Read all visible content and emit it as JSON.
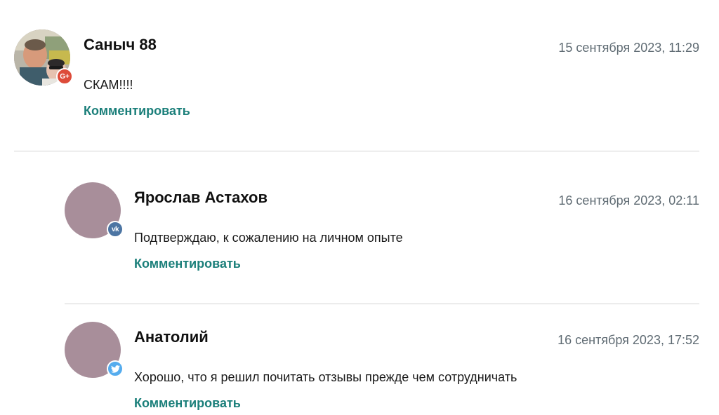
{
  "comments": [
    {
      "author": "Саныч 88",
      "date": "15 сентября 2023, 11:29",
      "text": "СКАМ!!!!",
      "reply_label": "Комментировать",
      "social_icon": "google-plus-icon",
      "social_glyph": "G+",
      "badge_color": "#dd4b39",
      "avatar": "photo"
    },
    {
      "author": "Ярослав Астахов",
      "date": "16 сентября 2023, 02:11",
      "text": "Подтверждаю, к сожалению на личном опыте",
      "reply_label": "Комментировать",
      "social_icon": "vk-icon",
      "social_glyph": "vk",
      "badge_color": "#4c75a3",
      "avatar": "placeholder"
    },
    {
      "author": "Анатолий",
      "date": "16 сентября 2023, 17:52",
      "text": "Хорошо, что я решил почитать отзывы прежде чем сотрудничать",
      "reply_label": "Комментировать",
      "social_icon": "twitter-icon",
      "social_glyph": "",
      "badge_color": "#55acee",
      "avatar": "placeholder"
    }
  ],
  "colors": {
    "link": "#1b7f7a",
    "date": "#5f6b73",
    "placeholder_avatar": "#a88e9a",
    "divider": "#d4d4d4"
  }
}
